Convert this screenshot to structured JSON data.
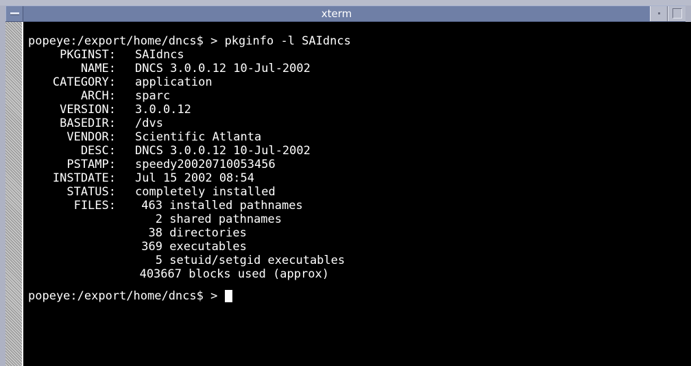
{
  "window": {
    "title": "xterm"
  },
  "terminal": {
    "prompt1": "popeye:/export/home/dncs$ > pkginfo -l SAIdncs",
    "fields": [
      {
        "key": "PKGINST:",
        "value": "SAIdncs"
      },
      {
        "key": "NAME:",
        "value": "DNCS 3.0.0.12 10-Jul-2002"
      },
      {
        "key": "CATEGORY:",
        "value": "application"
      },
      {
        "key": "ARCH:",
        "value": "sparc"
      },
      {
        "key": "VERSION:",
        "value": "3.0.0.12"
      },
      {
        "key": "BASEDIR:",
        "value": "/dvs"
      },
      {
        "key": "VENDOR:",
        "value": "Scientific Atlanta"
      },
      {
        "key": "DESC:",
        "value": "DNCS 3.0.0.12 10-Jul-2002"
      },
      {
        "key": "PSTAMP:",
        "value": "speedy20020710053456"
      },
      {
        "key": "INSTDATE:",
        "value": "Jul 15 2002 08:54"
      },
      {
        "key": "STATUS:",
        "value": "completely installed"
      }
    ],
    "files_key": "FILES:",
    "files": [
      {
        "count": "463",
        "label": "installed pathnames"
      },
      {
        "count": "2",
        "label": "shared pathnames"
      },
      {
        "count": "38",
        "label": "directories"
      },
      {
        "count": "369",
        "label": "executables"
      },
      {
        "count": "5",
        "label": "setuid/setgid executables"
      }
    ],
    "blocks": {
      "count": "403667",
      "label": "blocks used (approx)"
    },
    "prompt2": "popeye:/export/home/dncs$ > "
  },
  "icons": {
    "menu": "window-menu-icon",
    "minimize": "minimize-icon",
    "maximize": "maximize-icon",
    "cursor": "block-cursor"
  },
  "colors": {
    "terminal_bg": "#000000",
    "terminal_fg": "#ffffff",
    "titlebar": "#6f7fa6"
  }
}
